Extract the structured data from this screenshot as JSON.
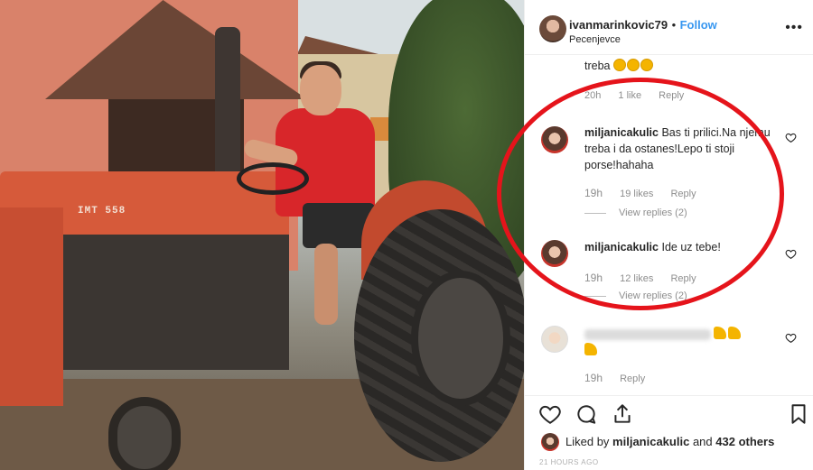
{
  "post": {
    "username": "ivanmarinkovic79",
    "separator": "•",
    "follow_label": "Follow",
    "location": "Pecenjevce",
    "more_label": "•••",
    "photo_badge": "IMT 558"
  },
  "comments": [
    {
      "text": "treba",
      "emoji_count": 3,
      "time": "20h",
      "likes": "1 like",
      "reply_label": "Reply"
    },
    {
      "username": "miljanicakulic",
      "text": "Bas ti prilici.Na njemu treba i da ostanes!Lepo ti stoji porse!hahaha",
      "time": "19h",
      "likes": "19 likes",
      "reply_label": "Reply",
      "view_replies": "View replies (2)"
    },
    {
      "username": "miljanicakulic",
      "text": "Ide uz tebe!",
      "time": "19h",
      "likes": "12 likes",
      "reply_label": "Reply",
      "view_replies": "View replies (2)"
    },
    {
      "username": "",
      "time": "19h",
      "reply_label": "Reply"
    }
  ],
  "footer": {
    "liked_by_prefix": "Liked by",
    "liked_by_user": "miljanicakulic",
    "liked_by_and": "and",
    "liked_by_others": "432 others",
    "time_ago": "21 HOURS AGO"
  },
  "icons": {
    "like": "heart-icon",
    "comment": "comment-icon",
    "share": "share-icon",
    "save": "bookmark-icon"
  },
  "colors": {
    "link": "#3897f0",
    "annotation": "#e5141b"
  }
}
